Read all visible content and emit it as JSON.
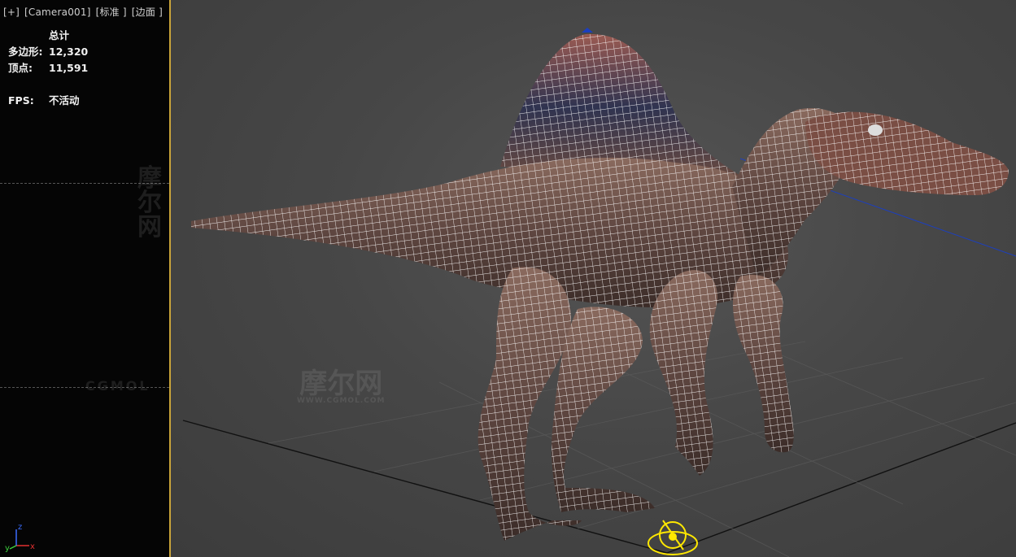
{
  "viewport": {
    "plus_label": "[+]",
    "camera_label": "[Camera001]",
    "shading_label": "[标准 ]",
    "edges_label": "[边面 ]"
  },
  "stats": {
    "header": "总计",
    "polys_label": "多边形:",
    "polys_value": "12,320",
    "verts_label": "顶点:",
    "verts_value": "11,591",
    "fps_label": "FPS:",
    "fps_value": "不活动"
  },
  "watermarks": {
    "brand_cn": "摩尔网",
    "brand_sub": "WWW.CGMOL.COM",
    "brand_en": "CGMOL"
  },
  "axis": {
    "x": "x",
    "y": "y",
    "z": "z"
  },
  "colors": {
    "divider": "#c9a43a",
    "wire": "#ffffff",
    "skin": "#6b5048",
    "helper": "#ffe800"
  }
}
